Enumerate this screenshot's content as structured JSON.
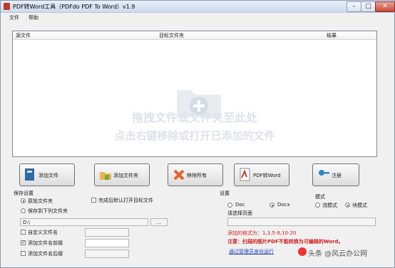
{
  "window": {
    "title": "PDF转Word工具（PDFdo PDF To Word）v1.9"
  },
  "menu": {
    "file": "文件",
    "help": "帮助"
  },
  "list": {
    "columns": [
      "源文件",
      "目标文件夹",
      "结果"
    ],
    "hint1": "拖拽文件或文件夹至此处",
    "hint2": "点击右键移除或打开已添加的文件"
  },
  "buttons": {
    "add_file": "添加文件",
    "add_folder": "添加文件夹",
    "remove_all": "移除所有",
    "convert": "PDF转Word",
    "register": "注册"
  },
  "save": {
    "title": "保存设置",
    "original": "原始文件夹",
    "saveto": "保存到下列文件夹",
    "open_after": "完成后默认打开目标文件",
    "path_value": "D:\\",
    "browse": "...",
    "custom_name": "自定义文件名",
    "add_prefix": "添加文件名前缀",
    "add_suffix": "添加文件名后缀"
  },
  "settings": {
    "title": "设置",
    "doc": "Doc",
    "docx": "Docx",
    "mode_title": "模式",
    "stream": "流模式",
    "block": "块模式",
    "pages_label": "请选择页面",
    "format_note": "添加的格式为：1,3,5-8,10-20",
    "warning": "注意：扫描的图片PDF不能转换为可编辑的Word。",
    "admin_link": "通过管理员身份运行"
  },
  "watermark": "头条 @风云办公网",
  "colors": {
    "accent_red": "#d11f1f",
    "link_blue": "#1f3fbf"
  }
}
